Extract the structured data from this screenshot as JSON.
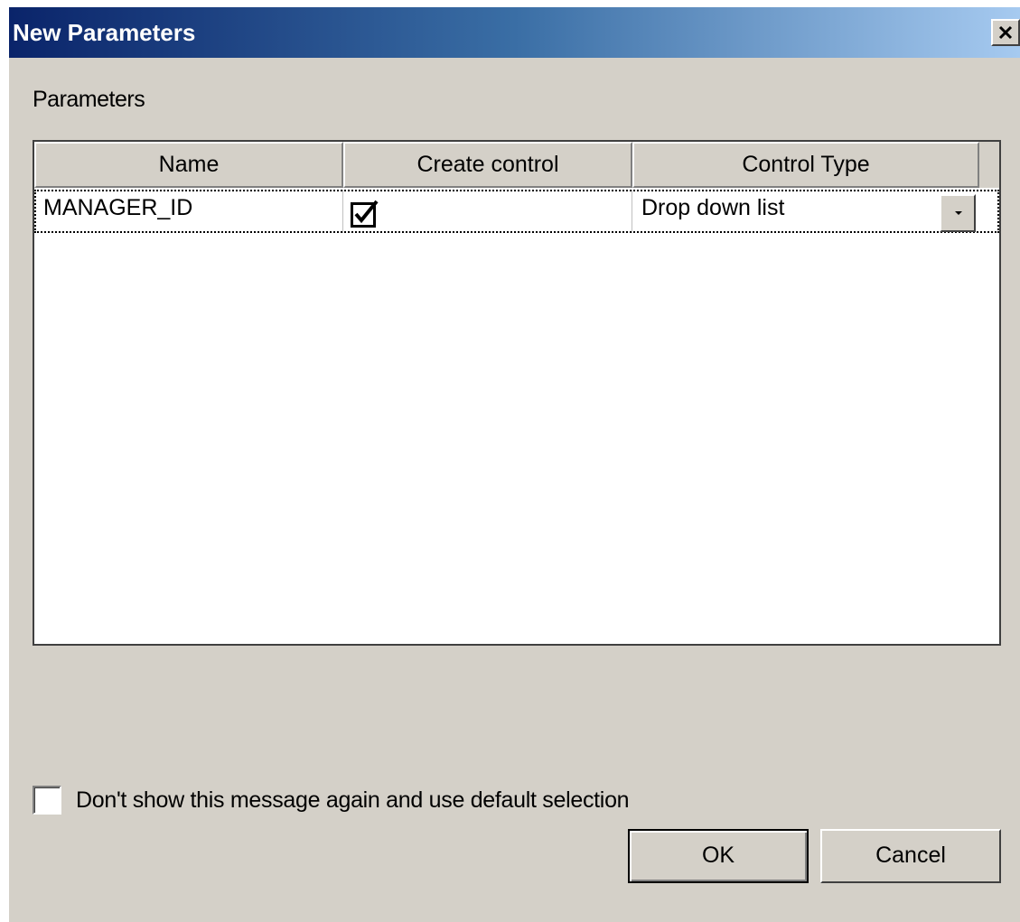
{
  "window": {
    "title": "New Parameters",
    "close_icon": "close-icon",
    "titlebar_colors": [
      "#0a246a",
      "#a6caf0"
    ],
    "face_color": "#d4d0c8"
  },
  "parameters": {
    "section_label": "Parameters",
    "columns": [
      "Name",
      "Create control",
      "Control Type"
    ],
    "rows": [
      {
        "name": "MANAGER_ID",
        "create_control": true,
        "control_type": "Drop down list"
      }
    ]
  },
  "options": {
    "dont_show_label": "Don't show this message again and use default selection",
    "dont_show_checked": false
  },
  "buttons": {
    "ok_label": "OK",
    "cancel_label": "Cancel"
  }
}
